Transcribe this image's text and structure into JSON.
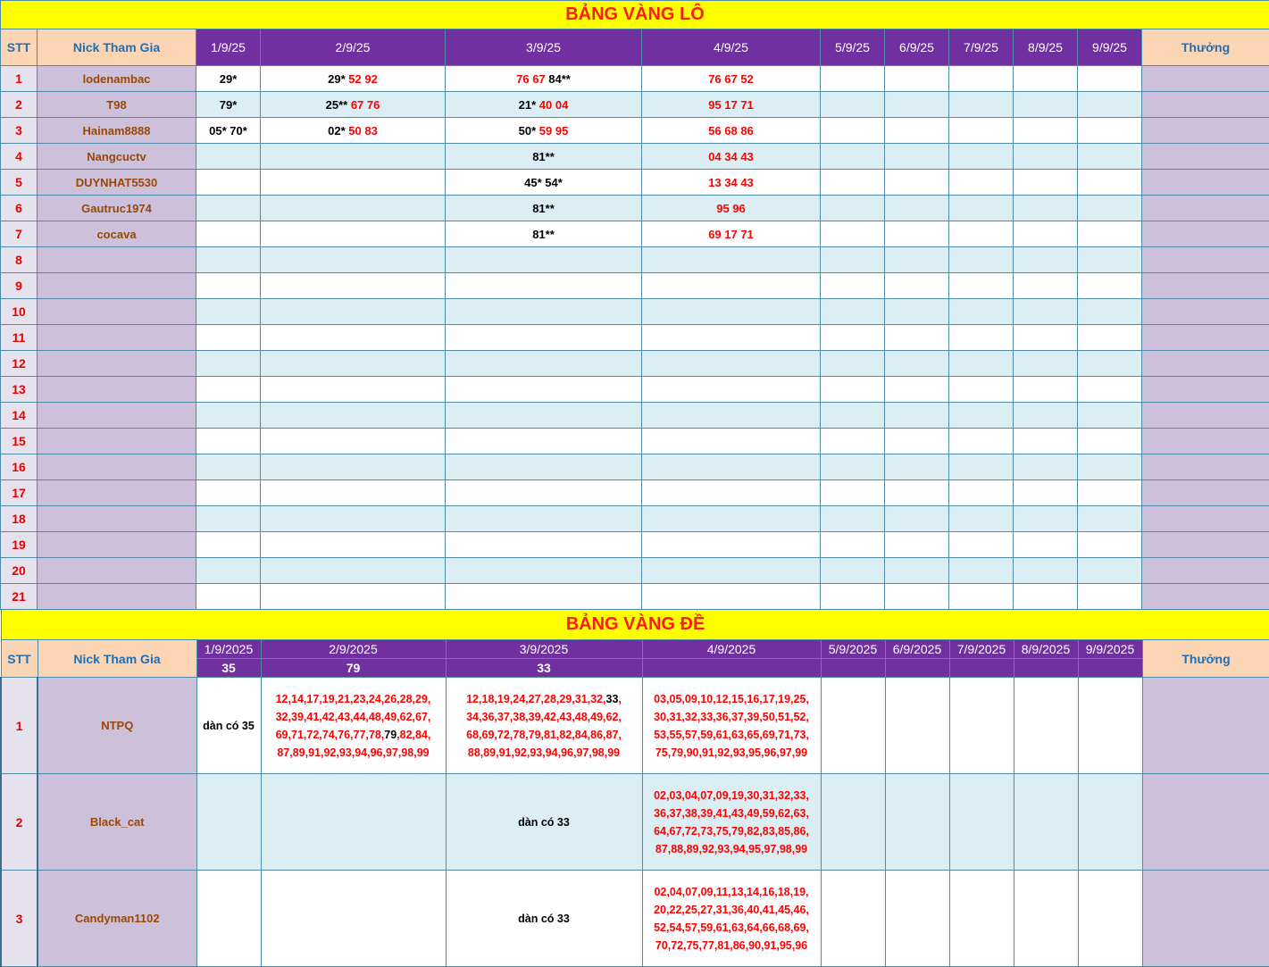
{
  "lo": {
    "title": "BẢNG VÀNG LÔ",
    "headers": {
      "stt": "STT",
      "nick": "Nick Tham Gia",
      "thuong": "Thưởng"
    },
    "dates": [
      "1/9/25",
      "2/9/25",
      "3/9/25",
      "4/9/25",
      "5/9/25",
      "6/9/25",
      "7/9/25",
      "8/9/25",
      "9/9/25"
    ],
    "rows": [
      {
        "stt": "1",
        "nick": "lodenambac",
        "cells": [
          [
            {
              "t": "29*",
              "c": "blk"
            }
          ],
          [
            {
              "t": "29*",
              "c": "blk"
            },
            {
              "t": " 52 92",
              "c": "red"
            }
          ],
          [
            {
              "t": "76 67 ",
              "c": "red"
            },
            {
              "t": "84**",
              "c": "blk"
            }
          ],
          [
            {
              "t": "76 67 52",
              "c": "red"
            }
          ],
          [],
          [],
          [],
          [],
          []
        ]
      },
      {
        "stt": "2",
        "nick": "T98",
        "cells": [
          [
            {
              "t": "79*",
              "c": "blk"
            }
          ],
          [
            {
              "t": "25**",
              "c": "blk"
            },
            {
              "t": " 67 76",
              "c": "red"
            }
          ],
          [
            {
              "t": "21*",
              "c": "blk"
            },
            {
              "t": " 40 04",
              "c": "red"
            }
          ],
          [
            {
              "t": "95 17 71",
              "c": "red"
            }
          ],
          [],
          [],
          [],
          [],
          []
        ]
      },
      {
        "stt": "3",
        "nick": "Hainam8888",
        "cells": [
          [
            {
              "t": "05* 70*",
              "c": "blk"
            }
          ],
          [
            {
              "t": "02*",
              "c": "blk"
            },
            {
              "t": " 50 83",
              "c": "red"
            }
          ],
          [
            {
              "t": "50*",
              "c": "blk"
            },
            {
              "t": " 59 95",
              "c": "red"
            }
          ],
          [
            {
              "t": "56 68 86",
              "c": "red"
            }
          ],
          [],
          [],
          [],
          [],
          []
        ]
      },
      {
        "stt": "4",
        "nick": "Nangcuctv",
        "cells": [
          [],
          [],
          [
            {
              "t": "81**",
              "c": "blk"
            }
          ],
          [
            {
              "t": "04 34 43",
              "c": "red"
            }
          ],
          [],
          [],
          [],
          [],
          []
        ]
      },
      {
        "stt": "5",
        "nick": "DUYNHAT5530",
        "cells": [
          [],
          [],
          [
            {
              "t": "45* 54*",
              "c": "blk"
            }
          ],
          [
            {
              "t": "13 34 43",
              "c": "red"
            }
          ],
          [],
          [],
          [],
          [],
          []
        ]
      },
      {
        "stt": "6",
        "nick": "Gautruc1974",
        "cells": [
          [],
          [],
          [
            {
              "t": "81**",
              "c": "blk"
            }
          ],
          [
            {
              "t": "95 96",
              "c": "red"
            }
          ],
          [],
          [],
          [],
          [],
          []
        ]
      },
      {
        "stt": "7",
        "nick": "cocava",
        "cells": [
          [],
          [],
          [
            {
              "t": "81**",
              "c": "blk"
            }
          ],
          [
            {
              "t": "69 17 71",
              "c": "red"
            }
          ],
          [],
          [],
          [],
          [],
          []
        ]
      },
      {
        "stt": "8",
        "nick": "",
        "cells": [
          [],
          [],
          [],
          [],
          [],
          [],
          [],
          [],
          []
        ]
      },
      {
        "stt": "9",
        "nick": "",
        "cells": [
          [],
          [],
          [],
          [],
          [],
          [],
          [],
          [],
          []
        ]
      },
      {
        "stt": "10",
        "nick": "",
        "cells": [
          [],
          [],
          [],
          [],
          [],
          [],
          [],
          [],
          []
        ]
      },
      {
        "stt": "11",
        "nick": "",
        "cells": [
          [],
          [],
          [],
          [],
          [],
          [],
          [],
          [],
          []
        ]
      },
      {
        "stt": "12",
        "nick": "",
        "cells": [
          [],
          [],
          [],
          [],
          [],
          [],
          [],
          [],
          []
        ]
      },
      {
        "stt": "13",
        "nick": "",
        "cells": [
          [],
          [],
          [],
          [],
          [],
          [],
          [],
          [],
          []
        ]
      },
      {
        "stt": "14",
        "nick": "",
        "cells": [
          [],
          [],
          [],
          [],
          [],
          [],
          [],
          [],
          []
        ]
      },
      {
        "stt": "15",
        "nick": "",
        "cells": [
          [],
          [],
          [],
          [],
          [],
          [],
          [],
          [],
          []
        ]
      },
      {
        "stt": "16",
        "nick": "",
        "cells": [
          [],
          [],
          [],
          [],
          [],
          [],
          [],
          [],
          []
        ]
      },
      {
        "stt": "17",
        "nick": "",
        "cells": [
          [],
          [],
          [],
          [],
          [],
          [],
          [],
          [],
          []
        ]
      },
      {
        "stt": "18",
        "nick": "",
        "cells": [
          [],
          [],
          [],
          [],
          [],
          [],
          [],
          [],
          []
        ]
      },
      {
        "stt": "19",
        "nick": "",
        "cells": [
          [],
          [],
          [],
          [],
          [],
          [],
          [],
          [],
          []
        ]
      },
      {
        "stt": "20",
        "nick": "",
        "cells": [
          [],
          [],
          [],
          [],
          [],
          [],
          [],
          [],
          []
        ]
      },
      {
        "stt": "21",
        "nick": "",
        "cells": [
          [],
          [],
          [],
          [],
          [],
          [],
          [],
          [],
          []
        ]
      }
    ]
  },
  "de": {
    "title": "BẢNG VÀNG ĐỀ",
    "headers": {
      "stt": "STT",
      "nick": "Nick Tham Gia",
      "thuong": "Thưởng"
    },
    "dates": [
      "1/9/2025",
      "2/9/2025",
      "3/9/2025",
      "4/9/2025",
      "5/9/2025",
      "6/9/2025",
      "7/9/2025",
      "8/9/2025",
      "9/9/2025"
    ],
    "results": [
      "35",
      "79",
      "33",
      "",
      "",
      "",
      "",
      "",
      ""
    ],
    "rows": [
      {
        "stt": "1",
        "nick": "NTPQ",
        "cells": [
          [
            {
              "t": "dàn có 35",
              "c": "blk"
            }
          ],
          [
            {
              "t": "12,14,17,19,21,23,24,26,28,29,",
              "c": "red"
            },
            {
              "t": "\n",
              "c": "br"
            },
            {
              "t": "32,39,41,42,43,44,48,49,62,67,",
              "c": "red"
            },
            {
              "t": "\n",
              "c": "br"
            },
            {
              "t": "69,71,72,74,76,77,78,",
              "c": "red"
            },
            {
              "t": "79",
              "c": "blk"
            },
            {
              "t": ",82,84,",
              "c": "red"
            },
            {
              "t": "\n",
              "c": "br"
            },
            {
              "t": "87,89,91,92,93,94,96,97,98,99",
              "c": "red"
            }
          ],
          [
            {
              "t": "12,18,19,24,27,28,29,31,32,",
              "c": "red"
            },
            {
              "t": "33",
              "c": "blk"
            },
            {
              "t": ",",
              "c": "red"
            },
            {
              "t": "\n",
              "c": "br"
            },
            {
              "t": "34,36,37,38,39,42,43,48,49,62,",
              "c": "red"
            },
            {
              "t": "\n",
              "c": "br"
            },
            {
              "t": "68,69,72,78,79,81,82,84,86,87,",
              "c": "red"
            },
            {
              "t": "\n",
              "c": "br"
            },
            {
              "t": "88,89,91,92,93,94,96,97,98,99",
              "c": "red"
            }
          ],
          [
            {
              "t": "03,05,09,10,12,15,16,17,19,25,",
              "c": "red"
            },
            {
              "t": "\n",
              "c": "br"
            },
            {
              "t": "30,31,32,33,36,37,39,50,51,52,",
              "c": "red"
            },
            {
              "t": "\n",
              "c": "br"
            },
            {
              "t": "53,55,57,59,61,63,65,69,71,73,",
              "c": "red"
            },
            {
              "t": "\n",
              "c": "br"
            },
            {
              "t": "75,79,90,91,92,93,95,96,97,99",
              "c": "red"
            }
          ],
          [],
          [],
          [],
          [],
          []
        ]
      },
      {
        "stt": "2",
        "nick": "Black_cat",
        "cells": [
          [],
          [],
          [
            {
              "t": "dàn có 33",
              "c": "blk"
            }
          ],
          [
            {
              "t": "02,03,04,07,09,19,30,31,32,33,",
              "c": "red"
            },
            {
              "t": "\n",
              "c": "br"
            },
            {
              "t": "36,37,38,39,41,43,49,59,62,63,",
              "c": "red"
            },
            {
              "t": "\n",
              "c": "br"
            },
            {
              "t": "64,67,72,73,75,79,82,83,85,86,",
              "c": "red"
            },
            {
              "t": "\n",
              "c": "br"
            },
            {
              "t": "87,88,89,92,93,94,95,97,98,99",
              "c": "red"
            }
          ],
          [],
          [],
          [],
          [],
          []
        ]
      },
      {
        "stt": "3",
        "nick": "Candyman1102",
        "cells": [
          [],
          [],
          [
            {
              "t": "dàn có 33",
              "c": "blk"
            }
          ],
          [
            {
              "t": "02,04,07,09,11,13,14,16,18,19,",
              "c": "red"
            },
            {
              "t": "\n",
              "c": "br"
            },
            {
              "t": "20,22,25,27,31,36,40,41,45,46,",
              "c": "red"
            },
            {
              "t": "\n",
              "c": "br"
            },
            {
              "t": "52,54,57,59,61,63,64,66,68,69,",
              "c": "red"
            },
            {
              "t": "\n",
              "c": "br"
            },
            {
              "t": "70,72,75,77,81,86,90,91,95,96",
              "c": "red"
            }
          ],
          [],
          [],
          [],
          [],
          []
        ]
      }
    ]
  }
}
